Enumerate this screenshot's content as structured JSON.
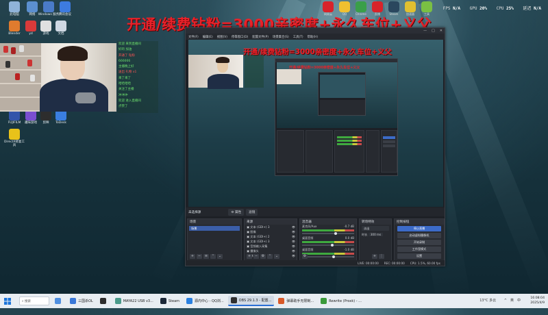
{
  "banner": {
    "main": "开通/续费钻粉=3000亲密度+永久车位+义父",
    "small": "开通/续费钻粉=3000亲密度+永久车位+义父",
    "tiny": "开通/续费钻粉=3000亲密度+永久车位+义父"
  },
  "stats": {
    "fps_label": "FPS",
    "fps_value": "N/A",
    "gpu_label": "GPU",
    "gpu_value": "20%",
    "cpu_label": "CPU",
    "cpu_value": "25%",
    "latency_label": "延迟",
    "latency_value": "N/A"
  },
  "desktop_icons": [
    {
      "label": "此电脑",
      "color": "#8fb3d9"
    },
    {
      "label": "网络",
      "color": "#5b8fd0"
    },
    {
      "label": "Windows\n服务",
      "color": "#4a7bc8"
    },
    {
      "label": "腾讯会议",
      "color": "#3d7be0"
    },
    {
      "label": "Blender",
      "color": "#e07b2e"
    },
    {
      "label": "yd",
      "color": "#d83a3a"
    },
    {
      "label": "游戏",
      "color": "#e0e0e0"
    },
    {
      "label": "文档",
      "color": "#cfd8e3"
    },
    {
      "label": "FUJIFILM",
      "color": "#3355aa"
    },
    {
      "label": "趣味游戏",
      "color": "#7a4fd0"
    },
    {
      "label": "剪映",
      "color": "#2d2d2d"
    },
    {
      "label": "ToDesk",
      "color": "#3a7ee0"
    },
    {
      "label": "DirectX修复工具",
      "color": "#e8c21a"
    }
  ],
  "tray_icons": [
    {
      "label": "网易云",
      "color": "#d8232a"
    },
    {
      "label": "QQ",
      "color": "#f0c030"
    },
    {
      "label": "Chrome",
      "color": "#3a9f48"
    },
    {
      "label": "直播",
      "color": "#d8232a"
    },
    {
      "label": "Steam",
      "color": "#2a475e"
    },
    {
      "label": "加速器",
      "color": "#e0c030"
    },
    {
      "label": "工具",
      "color": "#7ac043"
    }
  ],
  "chat": {
    "lines": [
      {
        "text": "欢迎 来到直播间",
        "color": "green"
      },
      {
        "text": "好的 加油",
        "color": "green"
      },
      {
        "text": "开通了 钻粉",
        "color": "red"
      },
      {
        "text": "666666",
        "color": "green"
      },
      {
        "text": "主播晚上好",
        "color": "green"
      },
      {
        "text": "送出 礼物 x1",
        "color": "red"
      },
      {
        "text": "来了来了",
        "color": "green"
      },
      {
        "text": "哈哈哈哈",
        "color": "green"
      },
      {
        "text": "关注了主播",
        "color": "green"
      },
      {
        "text": "冲冲冲",
        "color": "green"
      },
      {
        "text": "欢迎 进入直播间",
        "color": "green"
      },
      {
        "text": "点赞了",
        "color": "green"
      }
    ]
  },
  "obs": {
    "title_controls": [
      "—",
      "□",
      "✕"
    ],
    "menu": [
      "文件(F)",
      "编辑(E)",
      "视图(V)",
      "停靠窗口(D)",
      "配置文件(P)",
      "场景集合(S)",
      "工具(T)",
      "帮助(H)"
    ],
    "toolbar": {
      "scene_label": "未选择源",
      "props": "⚙ 属性",
      "filters": "滤镜"
    },
    "scenes": {
      "title": "场景",
      "items": [
        "场景"
      ]
    },
    "sources": {
      "title": "来源",
      "items": [
        "文本 (GDI+) 3",
        "图像",
        "文本 (GDI+) 2",
        "文本 (GDI+) 3",
        "音频输入采集",
        "摄像头",
        "弹幕"
      ]
    },
    "mixer": {
      "title": "混音器",
      "channels": [
        {
          "name": "麦克风/Aux",
          "db": "-0.7 dB",
          "level": 0.62
        },
        {
          "name": "桌面音频",
          "db": "0.0 dB",
          "level": 0.55
        },
        {
          "name": "桌面音频",
          "db": "-1.0 dB",
          "level": 0.58
        }
      ]
    },
    "transitions": {
      "title": "转场特效",
      "type": "淡出",
      "duration_label": "时长",
      "duration_value": "300 ms"
    },
    "controls": {
      "title": "控制按钮",
      "buttons": [
        "停止直播",
        "启动虚拟摄像机",
        "开始录制",
        "工作室模式",
        "设置",
        "退出"
      ]
    },
    "status": {
      "live": "LIVE: 00:00:00",
      "rec": "REC: 00:00:00",
      "cpu": "CPU: 1.5%, 60.00 fps"
    }
  },
  "taskbar": {
    "search": "搜索",
    "apps": [
      {
        "label": "",
        "color": "#4f8fe0"
      },
      {
        "label": "三国杀OL",
        "color": "#3a78d8"
      },
      {
        "label": "",
        "color": "#2d2d2d"
      },
      {
        "label": "MAYA22 USB v3...",
        "color": "#4a9a8a"
      },
      {
        "label": "Steam",
        "color": "#1b2838"
      },
      {
        "label": "源内中心 - QQ浏...",
        "color": "#2a80e0"
      },
      {
        "label": "OBS 29.1.3 - 配置...",
        "color": "#2f2f2f"
      },
      {
        "label": "弹幕助手无限制...",
        "color": "#d85a2a"
      },
      {
        "label": "Rewrite (Proxk) - ...",
        "color": "#3a9a3a"
      }
    ],
    "temp": "13°C 多云",
    "tray": [
      "^",
      "英",
      "中"
    ],
    "time": "16:08:04",
    "date": "2025/4/9"
  }
}
